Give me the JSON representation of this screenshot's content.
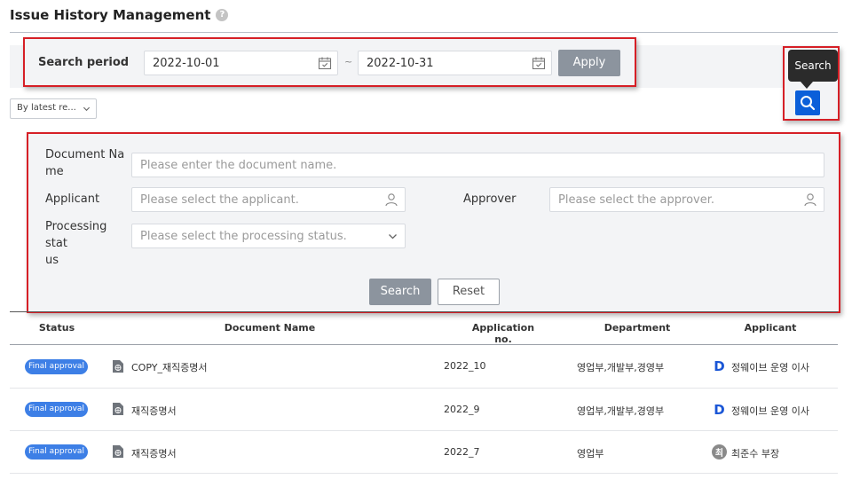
{
  "header": {
    "title": "Issue History Management",
    "help_glyph": "?"
  },
  "period": {
    "label": "Search period",
    "from": "2022-10-01",
    "separator": "~",
    "to": "2022-10-31",
    "apply_label": "Apply"
  },
  "search_toggle": {
    "tooltip": "Search",
    "icon": "search-icon"
  },
  "sort": {
    "selected": "By latest re..."
  },
  "filters": {
    "document_name_label": "Document Na\nme",
    "document_name_placeholder": "Please enter the document name.",
    "applicant_label": "Applicant",
    "applicant_placeholder": "Please select the applicant.",
    "approver_label": "Approver",
    "approver_placeholder": "Please select the approver.",
    "status_label": "Processing stat\nus",
    "status_placeholder": "Please select the processing status.",
    "search_label": "Search",
    "reset_label": "Reset"
  },
  "table": {
    "columns": [
      "Status",
      "Document Name",
      "Application no.",
      "Department",
      "Applicant"
    ],
    "rows": [
      {
        "status": "Final approval",
        "document": "COPY_재직증명서",
        "application_no": "2022_10",
        "department": "영업부,개발부,경영부",
        "applicant": "정웨이브 운영 이사",
        "avatar": "D"
      },
      {
        "status": "Final approval",
        "document": "재직증명서",
        "application_no": "2022_9",
        "department": "영업부,개발부,경영부",
        "applicant": "정웨이브 운영 이사",
        "avatar": "D"
      },
      {
        "status": "Final approval",
        "document": "재직증명서",
        "application_no": "2022_7",
        "department": "영업부",
        "applicant": "최준수 부장",
        "avatar": "최"
      }
    ]
  },
  "colors": {
    "accent_blue": "#0b5fd9",
    "badge_blue": "#3d7fe6",
    "highlight_red": "#d61f26",
    "button_gray": "#8c949e"
  }
}
